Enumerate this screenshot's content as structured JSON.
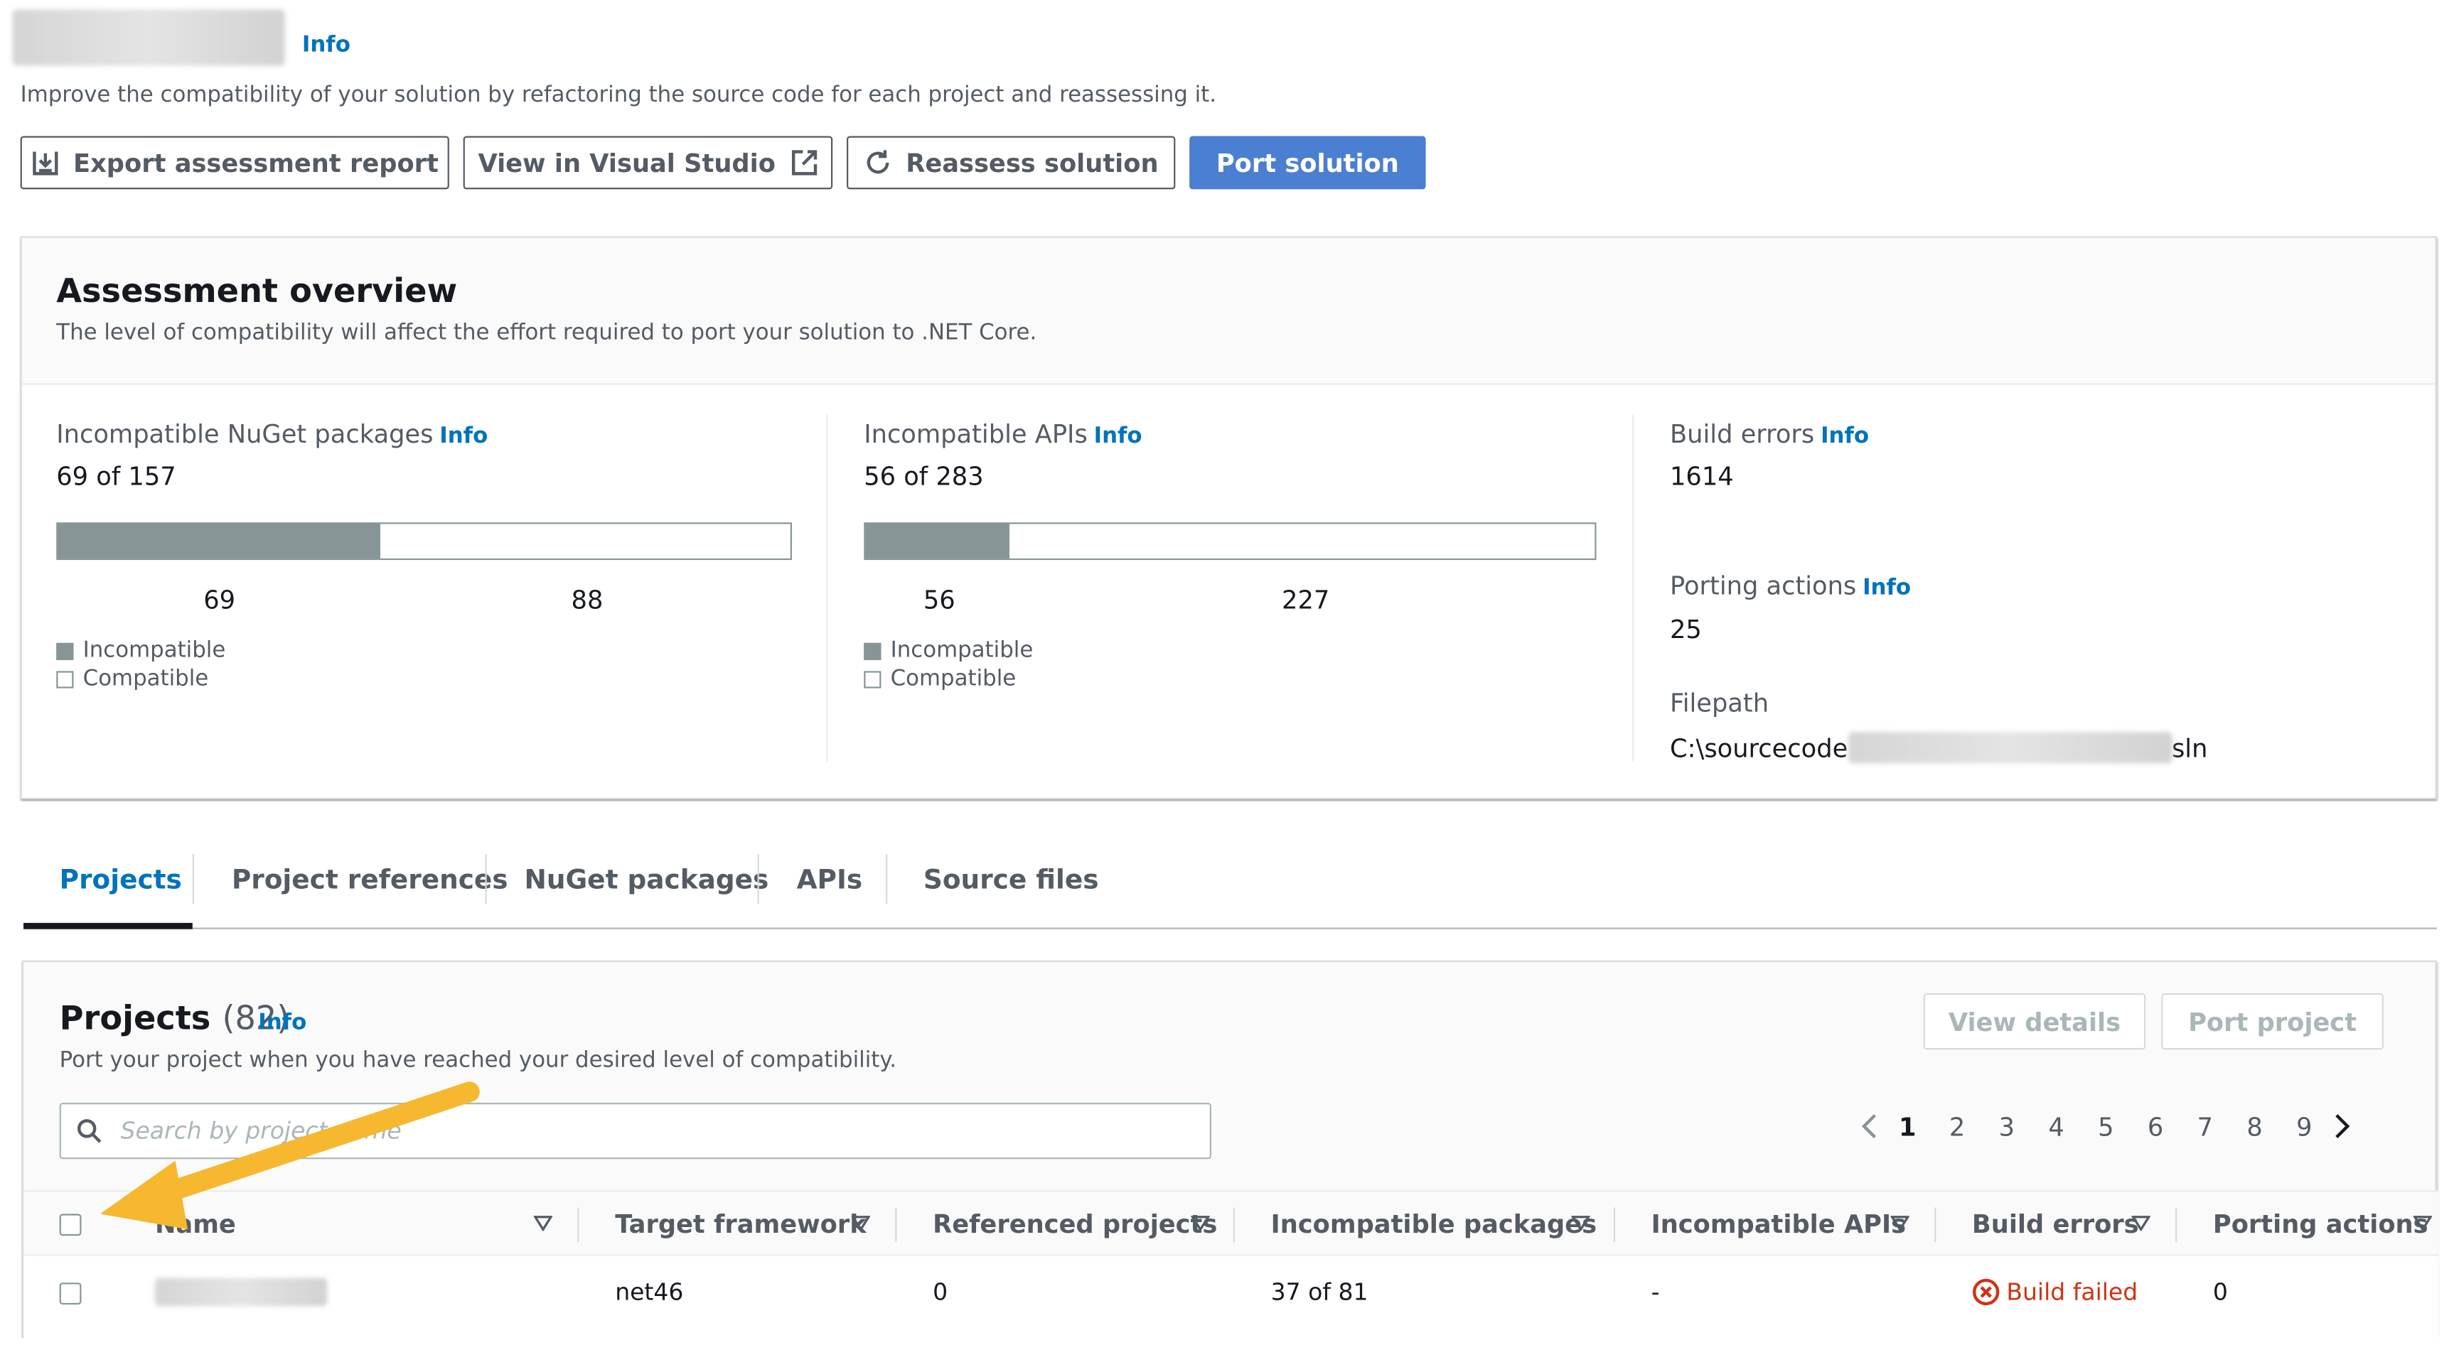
{
  "header": {
    "title_info": "Info",
    "subtitle": "Improve the compatibility of your solution by refactoring the source code for each project and reassessing it."
  },
  "actions": {
    "export": "Export assessment report",
    "view_vs": "View in Visual Studio",
    "reassess": "Reassess solution",
    "port": "Port solution"
  },
  "overview": {
    "title": "Assessment overview",
    "description": "The level of compatibility will affect the effort required to port your solution to .NET Core.",
    "nuget": {
      "label": "Incompatible NuGet packages",
      "info": "Info",
      "value": "69 of 157",
      "incompatible": 69,
      "compatible": 88,
      "incompatible_label": "69",
      "compatible_label": "88",
      "fraction": 0.44
    },
    "apis": {
      "label": "Incompatible APIs",
      "info": "Info",
      "value": "56 of 283",
      "incompatible": 56,
      "compatible": 227,
      "incompatible_label": "56",
      "compatible_label": "227",
      "fraction": 0.198
    },
    "legend": {
      "incompatible": "Incompatible",
      "compatible": "Compatible"
    },
    "build_errors": {
      "label": "Build errors",
      "info": "Info",
      "value": "1614"
    },
    "porting_actions": {
      "label": "Porting actions",
      "info": "Info",
      "value": "25"
    },
    "filepath": {
      "label": "Filepath",
      "prefix": "C:\\sourcecode",
      "suffix": "sln"
    }
  },
  "tabs": [
    {
      "label": "Projects",
      "active": true
    },
    {
      "label": "Project references"
    },
    {
      "label": "NuGet packages"
    },
    {
      "label": "APIs"
    },
    {
      "label": "Source files"
    }
  ],
  "projects": {
    "title": "Projects",
    "count": "(82)",
    "info": "Info",
    "description": "Port your project when you have reached your desired level of compatibility.",
    "view_details": "View details",
    "port_project": "Port project",
    "search_placeholder": "Search by project name",
    "pages": [
      "1",
      "2",
      "3",
      "4",
      "5",
      "6",
      "7",
      "8",
      "9"
    ],
    "current_page": "1",
    "columns": [
      "Name",
      "Target framework",
      "Referenced projects",
      "Incompatible packages",
      "Incompatible APIs",
      "Build errors",
      "Porting actions"
    ],
    "rows": [
      {
        "framework": "net46",
        "referenced": "0",
        "packages": "37 of 81",
        "apis": "-",
        "build_errors": "Build failed",
        "porting_actions": "0"
      }
    ]
  },
  "colors": {
    "accent": "#0073bb",
    "primary_button": "#4a7fd1",
    "bar": "#879596",
    "error": "#d13212",
    "arrow": "#f5b82e"
  }
}
